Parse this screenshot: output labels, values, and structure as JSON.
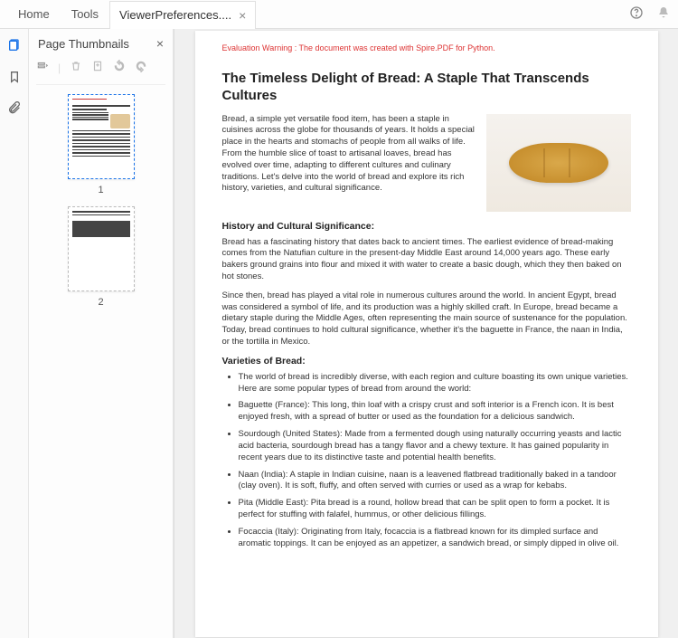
{
  "topbar": {
    "home": "Home",
    "tools": "Tools",
    "active_tab": "ViewerPreferences....",
    "close_glyph": "×"
  },
  "thumbnails": {
    "title": "Page Thumbnails",
    "close_glyph": "×",
    "page1_num": "1",
    "page2_num": "2"
  },
  "doc": {
    "warning": "Evaluation Warning : The document was created with Spire.PDF for Python.",
    "title": "The Timeless Delight of Bread: A Staple That Transcends Cultures",
    "intro": "Bread, a simple yet versatile food item, has been a staple in cuisines across the globe for thousands of years. It holds a special place in the hearts and stomachs of people from all walks of life. From the humble slice of toast to artisanal loaves, bread has evolved over time, adapting to different cultures and culinary traditions. Let's delve into the world of bread and explore its rich history, varieties, and cultural significance.",
    "sec1_title": "History and Cultural Significance:",
    "sec1_p1": "Bread has a fascinating history that dates back to ancient times. The earliest evidence of bread-making comes from the Natufian culture in the present-day Middle East around 14,000 years ago. These early bakers ground grains into flour and mixed it with water to create a basic dough, which they then baked on hot stones.",
    "sec1_p2": "Since then, bread has played a vital role in numerous cultures around the world. In ancient Egypt, bread was considered a symbol of life, and its production was a highly skilled craft. In Europe, bread became a dietary staple during the Middle Ages, often representing the main source of sustenance for the population. Today, bread continues to hold cultural significance, whether it's the baguette in France, the naan in India, or the tortilla in Mexico.",
    "sec2_title": "Varieties of Bread:",
    "list": [
      "The world of bread is incredibly diverse, with each region and culture boasting its own unique varieties. Here are some popular types of bread from around the world:",
      "Baguette (France): This long, thin loaf with a crispy crust and soft interior is a French icon. It is best enjoyed fresh, with a spread of butter or used as the foundation for a delicious sandwich.",
      "Sourdough (United States): Made from a fermented dough using naturally occurring yeasts and lactic acid bacteria, sourdough bread has a tangy flavor and a chewy texture. It has gained popularity in recent years due to its distinctive taste and potential health benefits.",
      "Naan (India): A staple in Indian cuisine, naan is a leavened flatbread traditionally baked in a tandoor (clay oven). It is soft, fluffy, and often served with curries or used as a wrap for kebabs.",
      "Pita (Middle East): Pita bread is a round, hollow bread that can be split open to form a pocket. It is perfect for stuffing with falafel, hummus, or other delicious fillings.",
      "Focaccia (Italy): Originating from Italy, focaccia is a flatbread known for its dimpled surface and aromatic toppings. It can be enjoyed as an appetizer, a sandwich bread, or simply dipped in olive oil."
    ]
  }
}
